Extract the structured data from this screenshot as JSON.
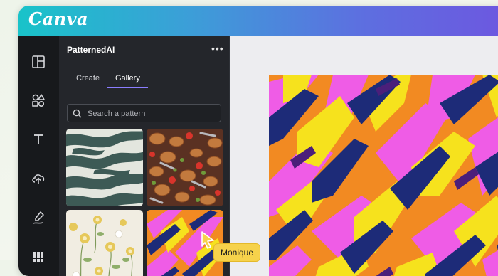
{
  "app": {
    "brand": "Canva"
  },
  "colors": {
    "topbar_start": "#19c3c9",
    "topbar_end": "#6d57e0",
    "accent": "#8b7dff",
    "collaborator": "#f6d24b"
  },
  "rail": {
    "icons": [
      "layout-icon",
      "elements-icon",
      "text-icon",
      "uploads-icon",
      "draw-icon",
      "apps-icon"
    ]
  },
  "panel": {
    "title": "PatternedAI",
    "more_label": "•••",
    "tabs": [
      {
        "label": "Create"
      },
      {
        "label": "Gallery",
        "active": true
      }
    ],
    "search": {
      "placeholder": "Search a pattern",
      "value": ""
    },
    "thumbnails": [
      "zebra-stripes-pattern",
      "food-plates-pattern",
      "floral-pattern",
      "brushstroke-pattern"
    ]
  },
  "collaborator": {
    "name": "Monique"
  }
}
